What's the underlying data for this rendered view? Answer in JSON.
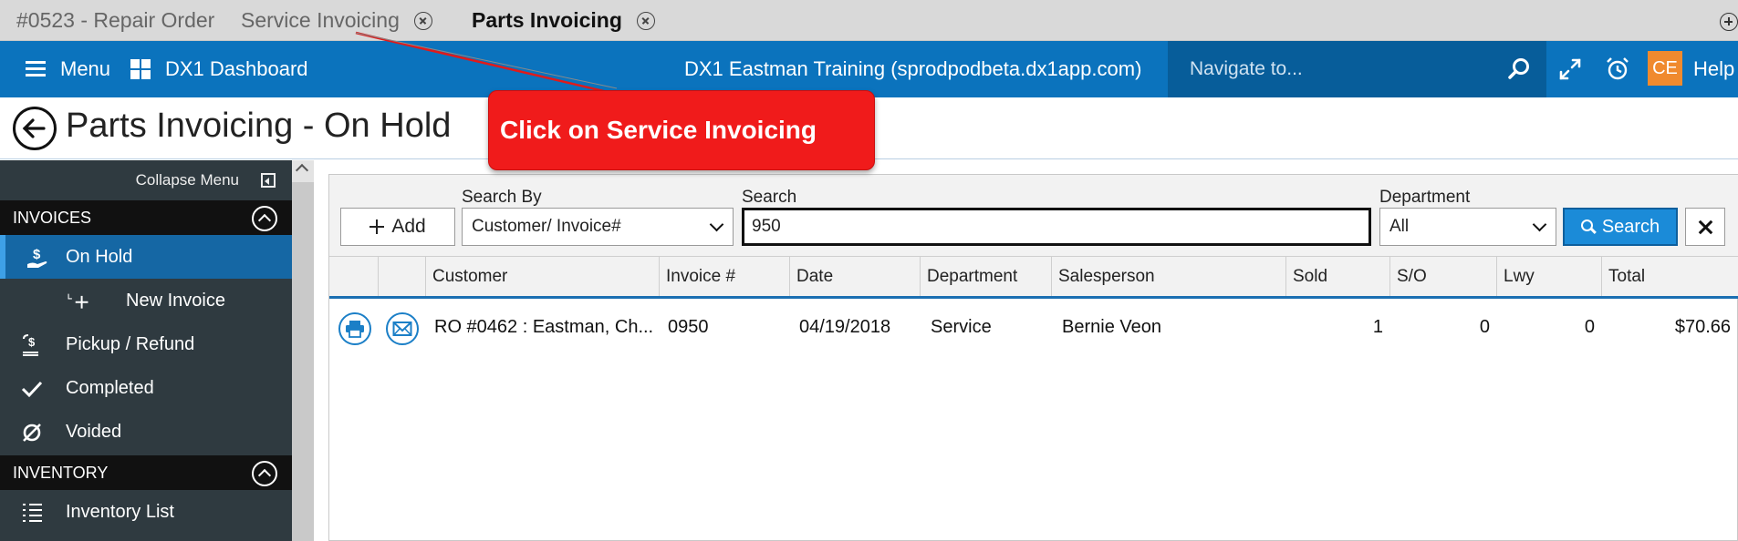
{
  "tabs": [
    {
      "label": "#0523 - Repair Order",
      "closable": false,
      "active": false
    },
    {
      "label": "Service Invoicing",
      "closable": true,
      "active": false
    },
    {
      "label": "Parts Invoicing",
      "closable": true,
      "active": true
    }
  ],
  "topnav": {
    "menu_label": "Menu",
    "dashboard_label": "DX1 Dashboard",
    "center_title": "DX1 Eastman Training (sprodpodbeta.dx1app.com)",
    "navigate_placeholder": "Navigate to...",
    "user_initials": "CE",
    "help_label": "Help",
    "colors": {
      "bar": "#0b73bd",
      "search_bg": "#075d9a",
      "badge": "#f08a2e"
    }
  },
  "page": {
    "title": "Parts Invoicing - On Hold"
  },
  "callout": {
    "text": "Click on Service Invoicing",
    "color": "#f01b1b"
  },
  "sidebar": {
    "collapse_label": "Collapse Menu",
    "sections": [
      {
        "title": "INVOICES",
        "items": [
          {
            "label": "On Hold",
            "icon": "dollar-hand-icon",
            "active": true
          },
          {
            "label": "New Invoice",
            "icon": "plus-icon",
            "sub": true
          },
          {
            "label": "Pickup / Refund",
            "icon": "refund-icon"
          },
          {
            "label": "Completed",
            "icon": "check-icon"
          },
          {
            "label": "Voided",
            "icon": "void-icon"
          }
        ]
      },
      {
        "title": "INVENTORY",
        "items": [
          {
            "label": "Inventory List",
            "icon": "list-icon"
          }
        ]
      }
    ]
  },
  "filters": {
    "add_label": "Add",
    "search_by_label": "Search By",
    "search_by_value": "Customer/ Invoice#",
    "search_label": "Search",
    "search_value": "950",
    "department_label": "Department",
    "department_value": "All",
    "search_button": "Search"
  },
  "table": {
    "columns": [
      "Customer",
      "Invoice #",
      "Date",
      "Department",
      "Salesperson",
      "Sold",
      "S/O",
      "Lwy",
      "Total"
    ],
    "rows": [
      {
        "customer": "RO #0462 : Eastman, Ch...",
        "invoice": "0950",
        "date": "04/19/2018",
        "department": "Service",
        "salesperson": "Bernie Veon",
        "sold": "1",
        "so": "0",
        "lwy": "0",
        "total": "$70.66"
      }
    ]
  }
}
